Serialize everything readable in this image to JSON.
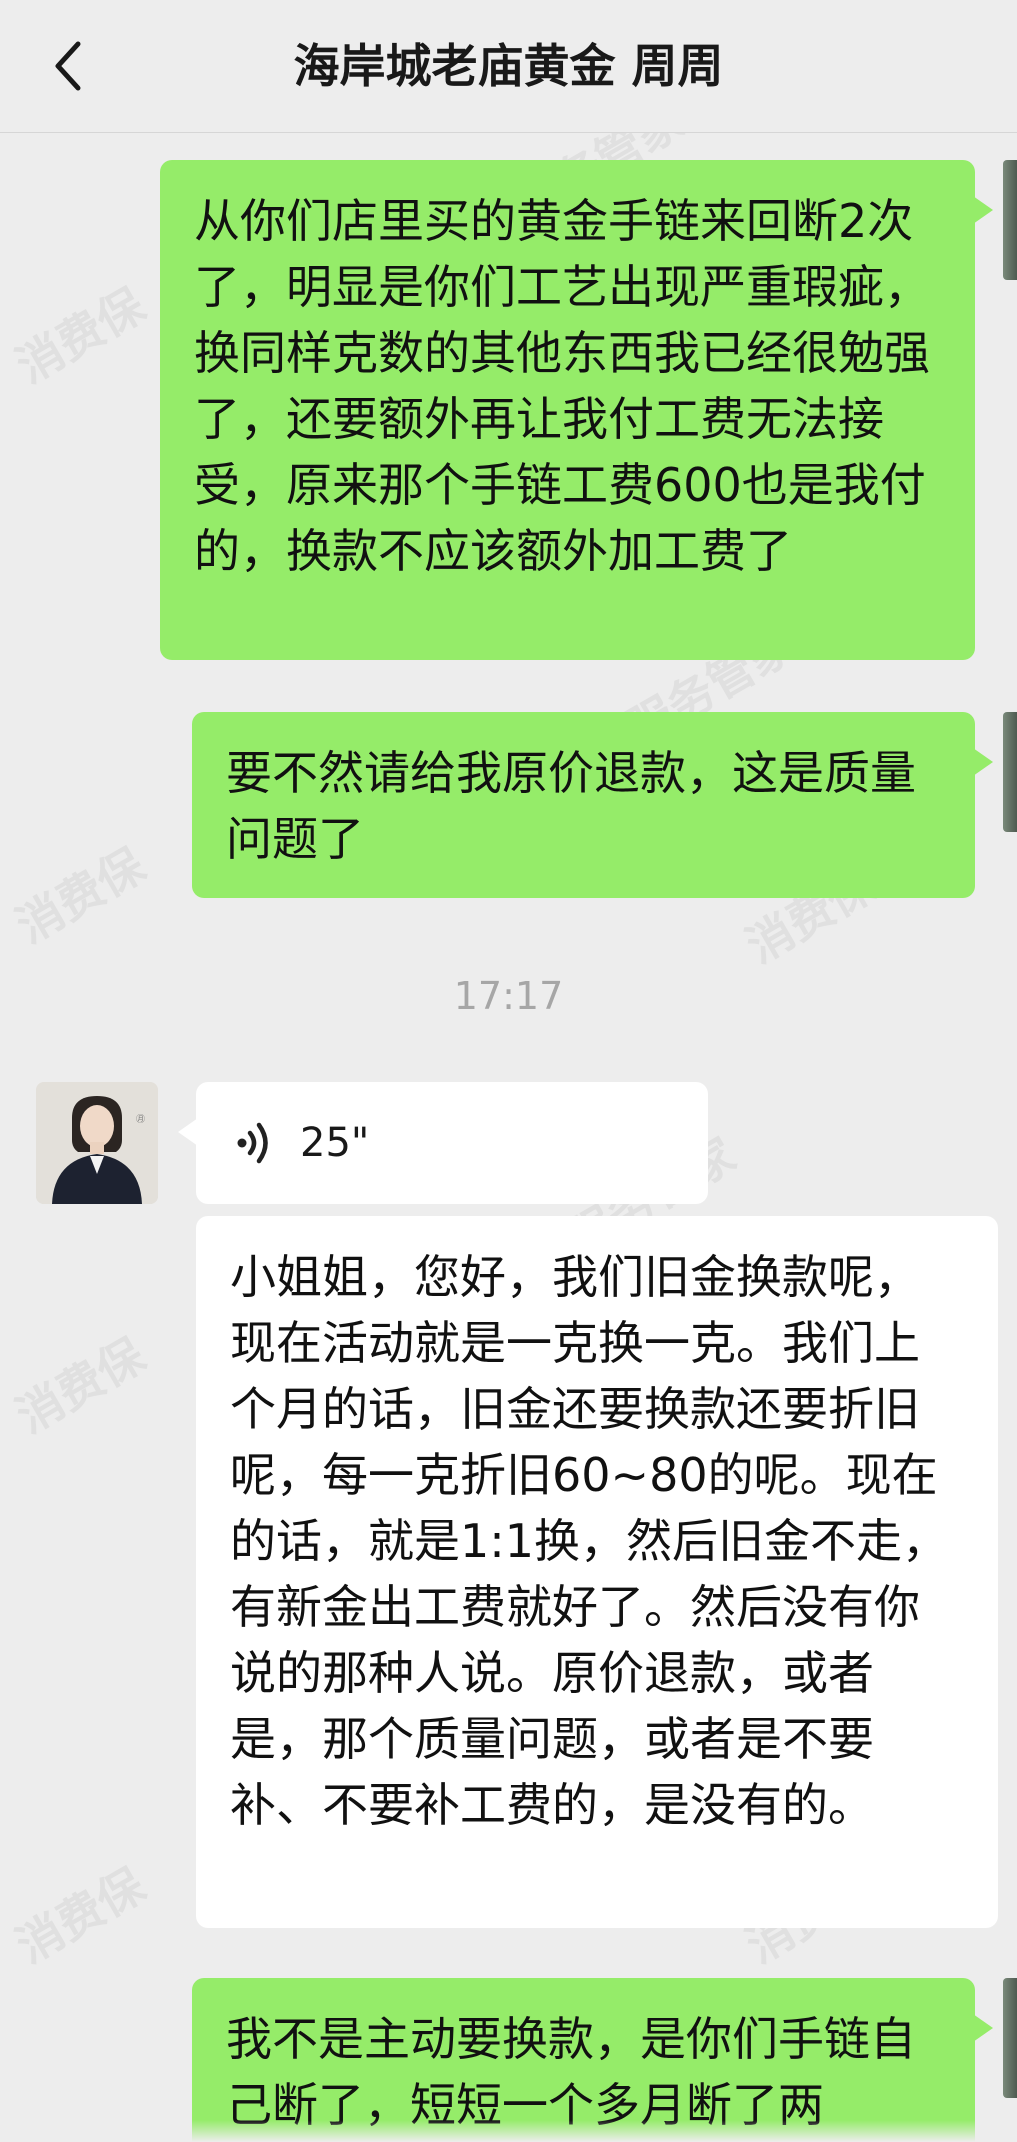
{
  "header": {
    "title": "海岸城老庙黄金  周周",
    "back_icon": "chevron-left-icon"
  },
  "messages": {
    "m1": "从你们店里买的黄金手链来回断2次了，明显是你们工艺出现严重瑕疵，换同样克数的其他东西我已经很勉强了，还要额外再让我付工费无法接受，原来那个手链工费600也是我付的，换款不应该额外加工费了",
    "m2": "要不然请给我原价退款，这是质量问题了",
    "time": "17:17",
    "voice_duration": "25\"",
    "m3": "小姐姐，您好，我们旧金换款呢，现在活动就是一克换一克。我们上个月的话，旧金还要换款还要折旧呢，每一克折旧60~80的呢。现在的话，就是1:1换，然后旧金不走，有新金出工费就好了。然后没有你说的那种人说。原价退款，或者是，那个质量问题，或者是不要补、不要补工费的，是没有的。",
    "m4": "我不是主动要换款，是你们手链自己断了，短短一个多月断了两"
  },
  "colors": {
    "sent_bubble": "#95ec69",
    "received_bubble": "#ffffff",
    "background": "#ededed"
  }
}
